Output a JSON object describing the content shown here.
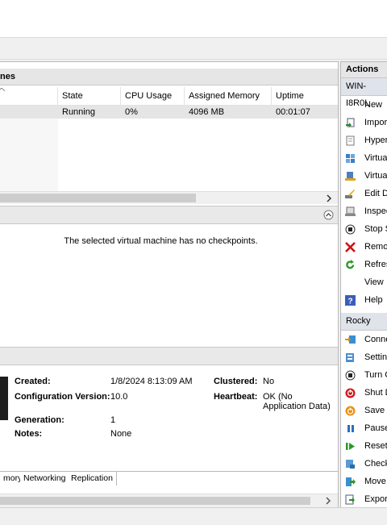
{
  "vm_pane": {
    "title": "nes",
    "columns": [
      "State",
      "CPU Usage",
      "Assigned Memory",
      "Uptime"
    ],
    "rows": [
      {
        "state": "Running",
        "cpu": "0%",
        "memory": "4096 MB",
        "uptime": "00:01:07"
      }
    ]
  },
  "checkpoints": {
    "message": "The selected virtual machine has no checkpoints."
  },
  "details": {
    "created_label": "Created:",
    "created_value": "1/8/2024 8:13:09 AM",
    "config_label": "Configuration Version:",
    "config_value": "10.0",
    "generation_label": "Generation:",
    "generation_value": "1",
    "notes_label": "Notes:",
    "notes_value": "None",
    "clustered_label": "Clustered:",
    "clustered_value": "No",
    "heartbeat_label": "Heartbeat:",
    "heartbeat_value_1": "OK (No",
    "heartbeat_value_2": "Application Data)",
    "tabs": [
      "mory",
      "Networking",
      "Replication"
    ]
  },
  "actions": {
    "title": "Actions",
    "host_group": "WIN-I8R0L",
    "host_items": [
      {
        "label": "New",
        "icon": "none"
      },
      {
        "label": "Impor",
        "icon": "import-icon"
      },
      {
        "label": "Hyper",
        "icon": "settings-page-icon"
      },
      {
        "label": "Virtua",
        "icon": "switch-manager-icon"
      },
      {
        "label": "Virtua",
        "icon": "san-manager-icon"
      },
      {
        "label": "Edit D",
        "icon": "edit-disk-icon"
      },
      {
        "label": "Inspec",
        "icon": "inspect-disk-icon"
      },
      {
        "label": "Stop S",
        "icon": "stop-service-icon"
      },
      {
        "label": "Remo",
        "icon": "remove-icon"
      },
      {
        "label": "Refres",
        "icon": "refresh-icon"
      },
      {
        "label": "View",
        "icon": "none"
      },
      {
        "label": "Help",
        "icon": "help-icon"
      }
    ],
    "vm_group": "Rocky",
    "vm_items": [
      {
        "label": "Conne",
        "icon": "connect-icon"
      },
      {
        "label": "Settin",
        "icon": "settings-icon"
      },
      {
        "label": "Turn C",
        "icon": "turn-off-icon"
      },
      {
        "label": "Shut D",
        "icon": "shutdown-icon"
      },
      {
        "label": "Save",
        "icon": "save-icon"
      },
      {
        "label": "Pause",
        "icon": "pause-icon"
      },
      {
        "label": "Reset",
        "icon": "reset-icon"
      },
      {
        "label": "Check",
        "icon": "checkpoint-icon"
      },
      {
        "label": "Move",
        "icon": "move-icon"
      },
      {
        "label": "Expor",
        "icon": "export-icon"
      }
    ]
  }
}
